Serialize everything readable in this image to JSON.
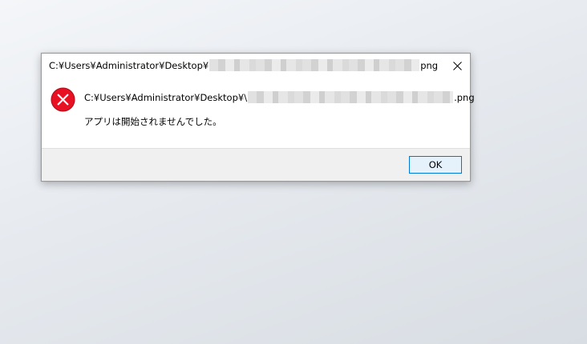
{
  "dialog": {
    "title_prefix": "C:¥Users¥Administrator¥Desktop¥",
    "title_suffix": "png",
    "path_prefix": "C:¥Users¥Administrator¥Desktop¥\\",
    "path_suffix": ".png",
    "message": "アプリは開始されませんでした。",
    "ok_label": "OK",
    "icons": {
      "close": "close-icon",
      "error": "error-icon"
    },
    "colors": {
      "error_red": "#e81123",
      "accent_border": "#0078d7",
      "button_fill": "#e5f1fb",
      "footer_bg": "#f0f0f0"
    }
  }
}
